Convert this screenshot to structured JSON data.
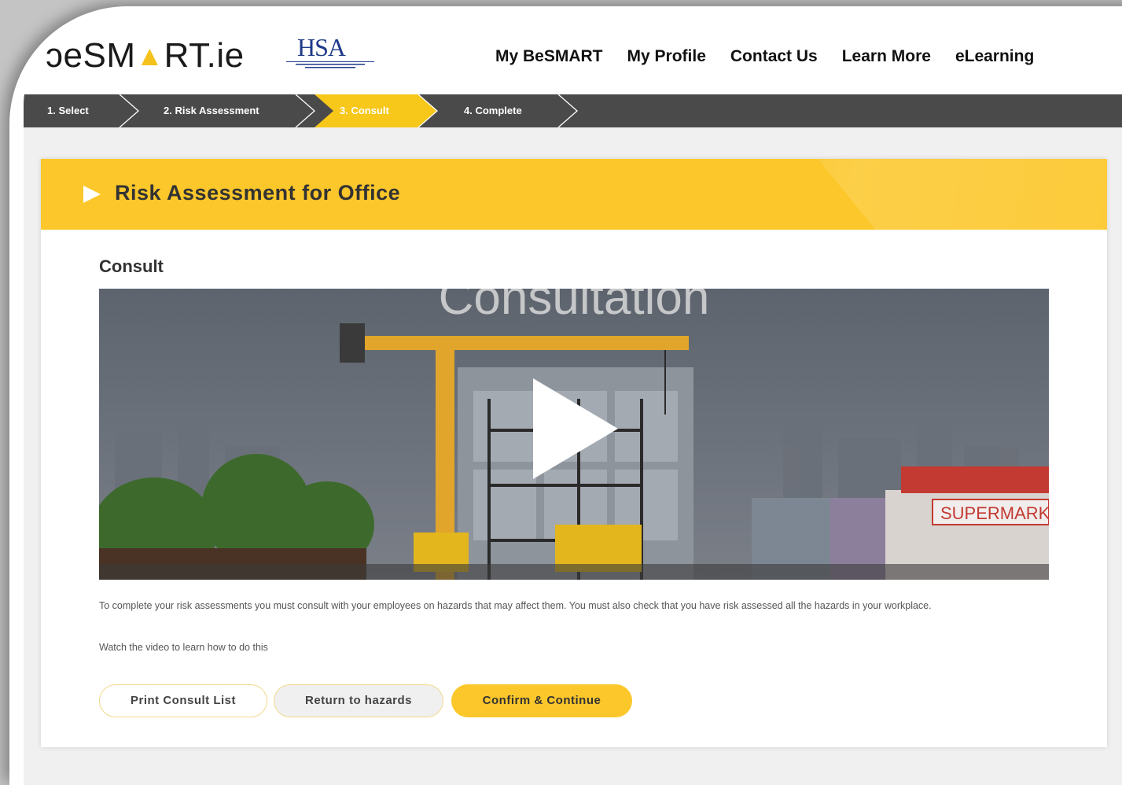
{
  "header": {
    "logo_prefix": "ɔeSM",
    "logo_suffix": "RT.ie",
    "hsa_mark": "HSA",
    "nav": [
      "My BeSMART",
      "My Profile",
      "Contact Us",
      "Learn More",
      "eLearning"
    ]
  },
  "steps": [
    "1. Select",
    "2. Risk Assessment",
    "3. Consult",
    "4. Complete"
  ],
  "active_step": "3. Consult",
  "card": {
    "title": "Risk Assessment for Office",
    "section_title": "Consult"
  },
  "video": {
    "overlay_title": "Consultation",
    "sign_text": "SUPERMARK"
  },
  "description": "To complete your risk assessments you must consult with your employees on hazards that may affect them. You must also check that you have risk assessed all the hazards in your workplace.",
  "instruction": "Watch the video to learn how to do this",
  "buttons": {
    "print": "Print Consult List",
    "return": "Return to hazards",
    "confirm": "Confirm & Continue"
  },
  "colors": {
    "accent_yellow": "#fcc72a",
    "steps_bar": "#4a4a4a",
    "hsa_blue": "#1f3a8a"
  }
}
